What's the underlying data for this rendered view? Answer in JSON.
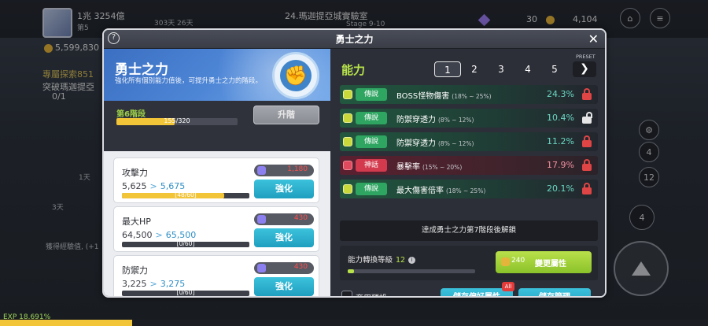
{
  "hud": {
    "name_line": "1兆 3254億",
    "level_line": "第5",
    "gold": "5,599,830",
    "quest_title": "專屬探索851",
    "quest_desc": "突破瑪迦提亞",
    "quest_progress": "0/1",
    "timer_a": "303天 26天",
    "location": "24.瑪迦提亞城實驗室",
    "stage_sub": "Stage 9-10",
    "gems": "30",
    "crystals": "4,104",
    "side_label_1d": "1天",
    "side_label_3d": "3天",
    "exp_log": "獲得經驗值, (+1",
    "exp_percent": "EXP 18.691%",
    "side_nums": [
      "4",
      "12",
      "4"
    ]
  },
  "dialog": {
    "title": "勇士之力",
    "help": "?",
    "close": "✕"
  },
  "left": {
    "banner_title": "勇士之力",
    "banner_sub": "強化所有個別能力值後，可提升勇士之力的階段。",
    "stage_label": "第6階段",
    "stage_progress_text": "155/320",
    "stage_progress": 0.48,
    "upgrade_label": "升階",
    "stats": [
      {
        "name": "攻擊力",
        "current": "5,625",
        "next": "5,675",
        "bar_text": "[48/60]",
        "progress": 0.8,
        "cost": "1,180",
        "enhance": "強化"
      },
      {
        "name": "最大HP",
        "current": "64,500",
        "next": "65,500",
        "bar_text": "[0/60]",
        "progress": 0,
        "cost": "430",
        "enhance": "強化"
      },
      {
        "name": "防禦力",
        "current": "3,225",
        "next": "3,275",
        "bar_text": "[0/60]",
        "progress": 0,
        "cost": "430",
        "enhance": "強化"
      }
    ]
  },
  "right": {
    "ability_title": "能力",
    "preset_label": "PRESET",
    "presets": [
      "1",
      "2",
      "3",
      "4",
      "5"
    ],
    "active_preset": "1",
    "next_icon": "❯",
    "abilities": [
      {
        "grade": "傳說",
        "name": "BOSS怪物傷害",
        "range": "(18% ~ 25%)",
        "value": "24.3%",
        "locked": true,
        "myth": false
      },
      {
        "grade": "傳說",
        "name": "防禦穿透力",
        "range": "(8% ~ 12%)",
        "value": "10.4%",
        "locked": false,
        "myth": false
      },
      {
        "grade": "傳說",
        "name": "防禦穿透力",
        "range": "(8% ~ 12%)",
        "value": "11.2%",
        "locked": true,
        "myth": false
      },
      {
        "grade": "神話",
        "name": "暴擊率",
        "range": "(15% ~ 20%)",
        "value": "17.9%",
        "locked": true,
        "myth": true
      },
      {
        "grade": "傳說",
        "name": "最大傷害倍率",
        "range": "(18% ~ 25%)",
        "value": "20.1%",
        "locked": true,
        "myth": false
      }
    ],
    "unlock_text": "達成勇士之力第7階段後解鎖",
    "convert_label": "能力轉換等級",
    "convert_level": "12",
    "info_icon": "i",
    "convert_progress": 0.05,
    "change_cost": "240",
    "change_label": "變更屬性",
    "use_preset_label": "套用預設",
    "save_pref_label": "儲存偏好屬性",
    "all_badge": "All",
    "save_manage_label": "儲存管理"
  },
  "colors": {
    "accent_green": "#b7e24a",
    "legend_grade": "#2fa562",
    "myth_grade": "#d43a4e",
    "button_cyan": "#1f9fbf",
    "progress_yellow": "#f2c438"
  }
}
